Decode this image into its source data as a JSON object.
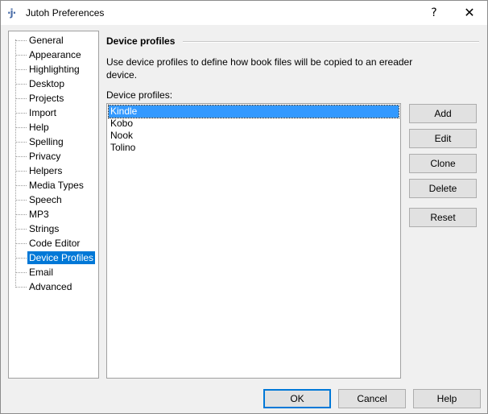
{
  "window": {
    "title": "Jutoh Preferences",
    "icon_text": "·j·",
    "help_glyph": "?",
    "close_glyph": "✕"
  },
  "tree": {
    "items": [
      {
        "label": "General"
      },
      {
        "label": "Appearance"
      },
      {
        "label": "Highlighting"
      },
      {
        "label": "Desktop"
      },
      {
        "label": "Projects"
      },
      {
        "label": "Import"
      },
      {
        "label": "Help"
      },
      {
        "label": "Spelling"
      },
      {
        "label": "Privacy"
      },
      {
        "label": "Helpers"
      },
      {
        "label": "Media Types"
      },
      {
        "label": "Speech"
      },
      {
        "label": "MP3"
      },
      {
        "label": "Strings"
      },
      {
        "label": "Code Editor"
      },
      {
        "label": "Device Profiles"
      },
      {
        "label": "Email"
      },
      {
        "label": "Advanced"
      }
    ],
    "selected": "Device Profiles"
  },
  "panel": {
    "title": "Device profiles",
    "description": "Use device profiles to define how book files will be copied to an ereader device.",
    "list_label": "Device profiles:",
    "profiles": [
      "Kindle",
      "Kobo",
      "Nook",
      "Tolino"
    ],
    "selected_profile": "Kindle",
    "buttons": {
      "add": "Add",
      "edit": "Edit",
      "clone": "Clone",
      "delete": "Delete",
      "reset": "Reset"
    }
  },
  "footer": {
    "ok": "OK",
    "cancel": "Cancel",
    "help": "Help"
  },
  "colors": {
    "selection": "#0078d7",
    "list_selection": "#3399ff",
    "button_face": "#e1e1e1"
  }
}
